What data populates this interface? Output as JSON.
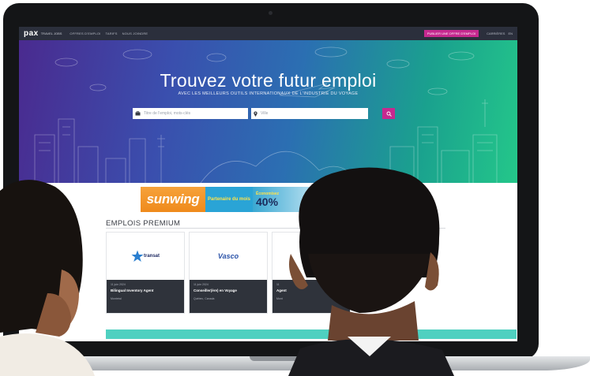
{
  "navbar": {
    "logo": "pax",
    "logo_sub": "TRAVEL JOBS",
    "links": [
      "OFFRES D'EMPLOI",
      "TARIFS",
      "NOUS JOINDRE"
    ],
    "cta": "PUBLIER UNE OFFRE D'EMPLOI",
    "right_links": [
      "CARRIÈRES",
      "EN"
    ]
  },
  "hero": {
    "title": "Trouvez votre futur emploi",
    "subtitle": "AVEC LES MEILLEURS OUTILS INTERNATIONAUX DE L'INDUSTRIE DU VOYAGE",
    "keyword_placeholder": "Titre de l'emploi, mots-clés",
    "location_placeholder": "Ville"
  },
  "banner": {
    "brand": "sunwing",
    "partner": "Partenaire du mois",
    "save": "Économisez",
    "percent": "40%"
  },
  "section": {
    "title": "EMPLOIS PREMIUM"
  },
  "cards": [
    {
      "company": "transat",
      "date": "11 juin 2024",
      "title": "Bilingual Inventory Agent",
      "location": "Montréal"
    },
    {
      "company": "Vasco",
      "date": "11 juin 2024",
      "title": "Conseiller(ère) en Voyage",
      "location": "Québec, Canada"
    },
    {
      "company": "",
      "date": "11",
      "title": "Agent",
      "location": "Mont"
    }
  ],
  "colors": {
    "nav_bg": "#2b2f3c",
    "accent": "#c6298f",
    "hero_start": "#4a2a8f",
    "hero_end": "#24c78a",
    "card_info_bg": "#2f333b",
    "teal": "#4fd0c0"
  },
  "icons": [
    "briefcase-icon",
    "location-pin-icon",
    "search-icon"
  ]
}
